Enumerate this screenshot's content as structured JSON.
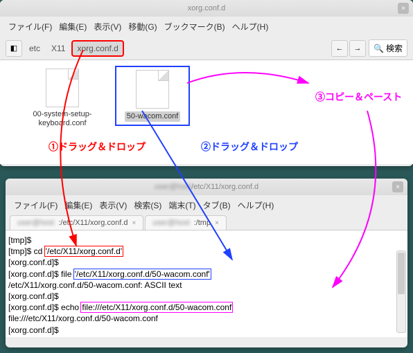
{
  "win1": {
    "title": "xorg.conf.d",
    "menu": [
      "ファイル(F)",
      "編集(E)",
      "表示(V)",
      "移動(G)",
      "ブックマーク(B)",
      "ヘルプ(H)"
    ],
    "crumbs": [
      "etc",
      "X11",
      "xorg.conf.d"
    ],
    "search": "検索",
    "files": [
      {
        "name": "00-system-setup-keyboard.conf"
      },
      {
        "name": "50-wacom.conf"
      }
    ]
  },
  "win2": {
    "title_suffix": "/etc/X11/xorg.conf.d",
    "menu": [
      "ファイル(F)",
      "編集(E)",
      "表示(V)",
      "検索(S)",
      "端末(T)",
      "タブ(B)",
      "ヘルプ(H)"
    ],
    "tabs": [
      {
        "label": ":/etc/X11/xorg.conf.d"
      },
      {
        "label": ":/tmp"
      }
    ],
    "term": {
      "l1": "[tmp]$",
      "l2a": "[tmp]$ cd ",
      "l2b": "'/etc/X11/xorg.conf.d'",
      "l3": "[xorg.conf.d]$",
      "l4a": "[xorg.conf.d]$ file ",
      "l4b": "'/etc/X11/xorg.conf.d/50-wacom.conf'",
      "l5": "/etc/X11/xorg.conf.d/50-wacom.conf: ASCII text",
      "l6": "[xorg.conf.d]$",
      "l7a": "[xorg.conf.d]$ echo ",
      "l7b": "file:///etc/X11/xorg.conf.d/50-wacom.conf",
      "l8": "file:///etc/X11/xorg.conf.d/50-wacom.conf",
      "l9": "[xorg.conf.d]$"
    }
  },
  "annotations": {
    "a1": "①ドラッグ＆ドロップ",
    "a2": "②ドラッグ＆ドロップ",
    "a3": "③コピー＆ペースト"
  }
}
